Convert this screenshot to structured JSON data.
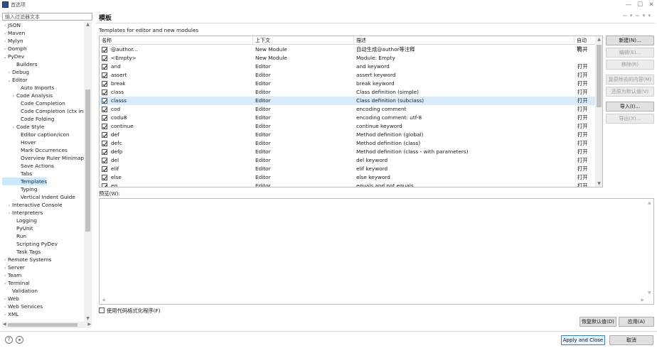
{
  "window": {
    "title": "首选项",
    "minimize": "—",
    "maximize": "☐",
    "close": "✕"
  },
  "filter": {
    "placeholder": "输入过滤器文本"
  },
  "tree": [
    {
      "label": "JSON",
      "arrow": "›",
      "indent": 0
    },
    {
      "label": "Maven",
      "arrow": "›",
      "indent": 0
    },
    {
      "label": "Mylyn",
      "arrow": "›",
      "indent": 0
    },
    {
      "label": "Oomph",
      "arrow": "›",
      "indent": 0
    },
    {
      "label": "PyDev",
      "arrow": "⌄",
      "indent": 0
    },
    {
      "label": "Builders",
      "arrow": "",
      "indent": 2
    },
    {
      "label": "Debug",
      "arrow": "›",
      "indent": 1
    },
    {
      "label": "Editor",
      "arrow": "⌄",
      "indent": 1
    },
    {
      "label": "Auto Imports",
      "arrow": "",
      "indent": 3
    },
    {
      "label": "Code Analysis",
      "arrow": "›",
      "indent": 2
    },
    {
      "label": "Code Completion",
      "arrow": "",
      "indent": 3
    },
    {
      "label": "Code Completion (ctx insensitive)",
      "arrow": "",
      "indent": 3
    },
    {
      "label": "Code Folding",
      "arrow": "",
      "indent": 3
    },
    {
      "label": "Code Style",
      "arrow": "›",
      "indent": 2
    },
    {
      "label": "Editor caption/icon",
      "arrow": "",
      "indent": 3
    },
    {
      "label": "Hover",
      "arrow": "",
      "indent": 3
    },
    {
      "label": "Mark Occurrences",
      "arrow": "",
      "indent": 3
    },
    {
      "label": "Overview Ruler Minimap",
      "arrow": "",
      "indent": 3
    },
    {
      "label": "Save Actions",
      "arrow": "",
      "indent": 3
    },
    {
      "label": "Tabs",
      "arrow": "",
      "indent": 3
    },
    {
      "label": "Templates",
      "arrow": "",
      "indent": 3,
      "selected": true
    },
    {
      "label": "Typing",
      "arrow": "",
      "indent": 3
    },
    {
      "label": "Vertical Indent Guide",
      "arrow": "",
      "indent": 3
    },
    {
      "label": "Interactive Console",
      "arrow": "›",
      "indent": 1
    },
    {
      "label": "Interpreters",
      "arrow": "›",
      "indent": 1
    },
    {
      "label": "Logging",
      "arrow": "",
      "indent": 2
    },
    {
      "label": "PyUnit",
      "arrow": "",
      "indent": 2
    },
    {
      "label": "Run",
      "arrow": "",
      "indent": 2
    },
    {
      "label": "Scripting PyDev",
      "arrow": "",
      "indent": 2
    },
    {
      "label": "Task Tags",
      "arrow": "",
      "indent": 2
    },
    {
      "label": "Remote Systems",
      "arrow": "›",
      "indent": 0
    },
    {
      "label": "Server",
      "arrow": "›",
      "indent": 0
    },
    {
      "label": "Team",
      "arrow": "›",
      "indent": 0
    },
    {
      "label": "Terminal",
      "arrow": "›",
      "indent": 0
    },
    {
      "label": "Validation",
      "arrow": "",
      "indent": 1
    },
    {
      "label": "Web",
      "arrow": "›",
      "indent": 0
    },
    {
      "label": "Web Services",
      "arrow": "›",
      "indent": 0
    },
    {
      "label": "XML",
      "arrow": "›",
      "indent": 0
    }
  ],
  "page": {
    "title": "模板",
    "nav_arrows": "⇦ ▾ ⇨ ▾ ▾",
    "section_label": "Templates for editor and new modules",
    "columns": {
      "name": "名称",
      "context": "上下文",
      "description": "描述",
      "auto_insert": "自动插..."
    },
    "templates": [
      {
        "name": "@author...",
        "context": "New Module",
        "description": "自动生成@author等注释",
        "auto": "打开",
        "checked": true
      },
      {
        "name": "<Empty>",
        "context": "New Module",
        "description": "Module: Empty",
        "auto": "",
        "checked": true
      },
      {
        "name": "and",
        "context": "Editor",
        "description": "and keyword",
        "auto": "打开",
        "checked": true
      },
      {
        "name": "assert",
        "context": "Editor",
        "description": "assert keyword",
        "auto": "打开",
        "checked": true
      },
      {
        "name": "break",
        "context": "Editor",
        "description": "break keyword",
        "auto": "打开",
        "checked": true
      },
      {
        "name": "class",
        "context": "Editor",
        "description": "Class definition (simple)",
        "auto": "打开",
        "checked": true
      },
      {
        "name": "classs",
        "context": "Editor",
        "description": "Class definition (subclass)",
        "auto": "打开",
        "checked": true,
        "selected": true
      },
      {
        "name": "cod",
        "context": "Editor",
        "description": "encoding comment",
        "auto": "打开",
        "checked": true
      },
      {
        "name": "codu8",
        "context": "Editor",
        "description": "encoding comment: utf-8",
        "auto": "打开",
        "checked": true
      },
      {
        "name": "continue",
        "context": "Editor",
        "description": "continue keyword",
        "auto": "打开",
        "checked": true
      },
      {
        "name": "def",
        "context": "Editor",
        "description": "Method definition (global)",
        "auto": "打开",
        "checked": true
      },
      {
        "name": "defc",
        "context": "Editor",
        "description": "Method definition (class)",
        "auto": "打开",
        "checked": true
      },
      {
        "name": "defp",
        "context": "Editor",
        "description": "Method definition (class - with parameters)",
        "auto": "打开",
        "checked": true
      },
      {
        "name": "del",
        "context": "Editor",
        "description": "del keyword",
        "auto": "打开",
        "checked": true
      },
      {
        "name": "elif",
        "context": "Editor",
        "description": "elif keyword",
        "auto": "打开",
        "checked": true
      },
      {
        "name": "else",
        "context": "Editor",
        "description": "else keyword",
        "auto": "打开",
        "checked": true
      },
      {
        "name": "eq",
        "context": "Editor",
        "description": "equals and not equals",
        "auto": "打开",
        "checked": true
      }
    ],
    "buttons": {
      "new": "新建(N)...",
      "edit": "编辑(E)...",
      "remove": "移除(R)",
      "restore_removed": "复原除去的内容(M)",
      "revert_default": "还原为默认值(V)",
      "import": "导入(I)...",
      "export": "导出(X)..."
    },
    "preview_label": "预览(W):",
    "use_formatter": "使用代码格式化程序(F)",
    "restore_defaults": "恢复默认值(D)",
    "apply": "应用(A)"
  },
  "footer": {
    "apply_close": "Apply and Close",
    "cancel": "取消",
    "help_icon": "?"
  }
}
